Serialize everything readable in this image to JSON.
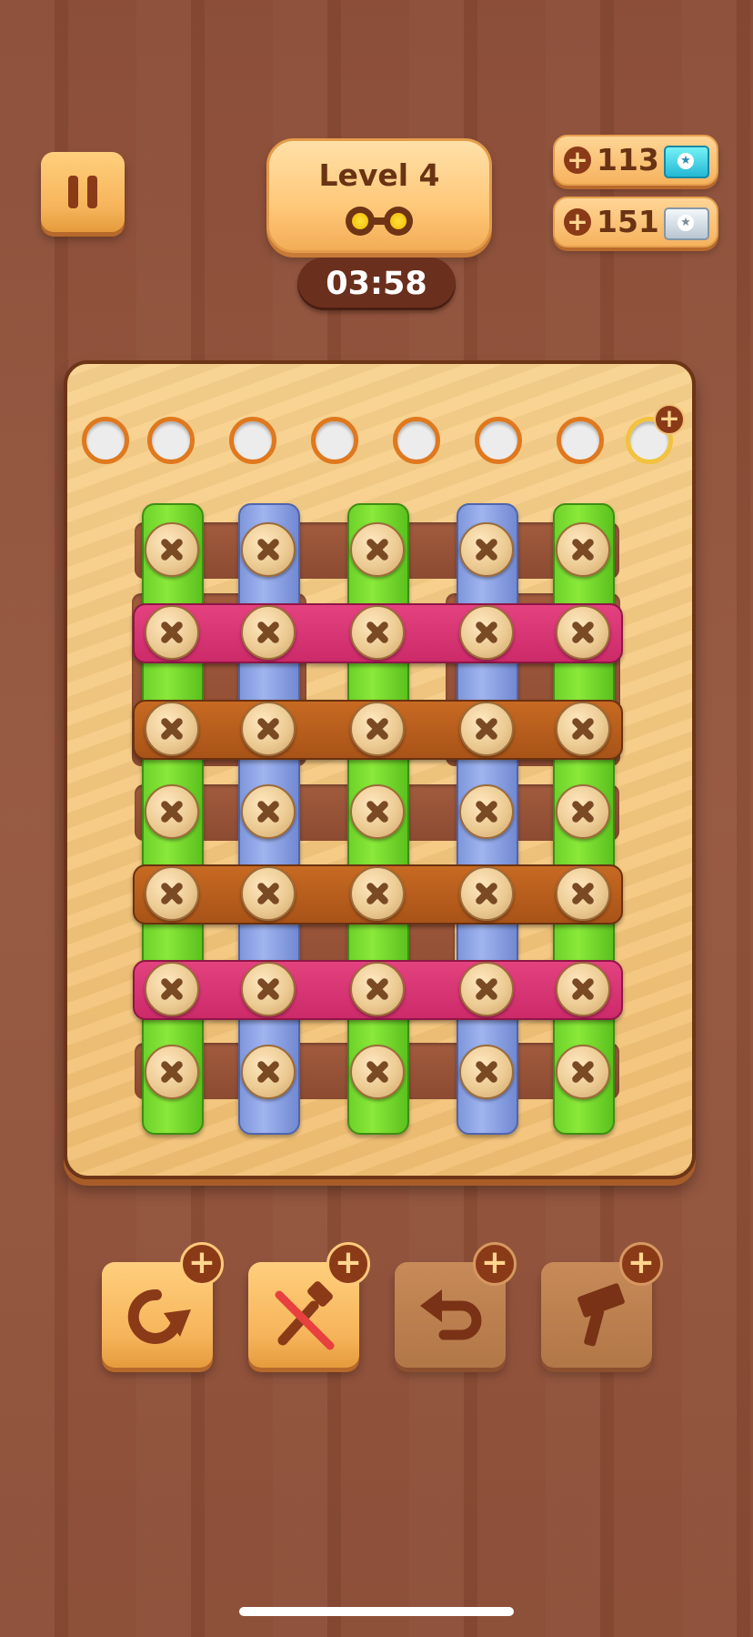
{
  "header": {
    "level_label": "Level 4",
    "timer": "03:58"
  },
  "currencies": [
    {
      "amount": "113",
      "icon": "blue-ticket-icon",
      "color": "#2bc2dc"
    },
    {
      "amount": "151",
      "icon": "silver-ticket-icon",
      "color": "#b8c6d2"
    }
  ],
  "plus_glyph": "+",
  "board": {
    "empty_holes": 7,
    "locked_holes": 1,
    "vertical_bar_colors": [
      "green",
      "blue",
      "green",
      "blue",
      "green"
    ],
    "horizontal_bar_colors": [
      "pink",
      "orange",
      "orange",
      "pink"
    ],
    "screw_rows": 7,
    "screw_columns": 5
  },
  "boosters": [
    {
      "name": "rotate-booster",
      "icon": "rotate-arrow-icon",
      "enabled": true
    },
    {
      "name": "remove-screw-booster",
      "icon": "crossed-screw-icon",
      "enabled": true
    },
    {
      "name": "undo-booster",
      "icon": "undo-arrow-icon",
      "enabled": false
    },
    {
      "name": "hammer-booster",
      "icon": "hammer-icon",
      "enabled": false
    }
  ],
  "colors": {
    "background": "#8a4b35",
    "board": "#f2c073",
    "green_bar": "#7ad931",
    "blue_bar": "#8aa2e2",
    "pink_bar": "#d8336f",
    "orange_bar": "#b85e1d",
    "hole_ring": "#e0781e"
  }
}
